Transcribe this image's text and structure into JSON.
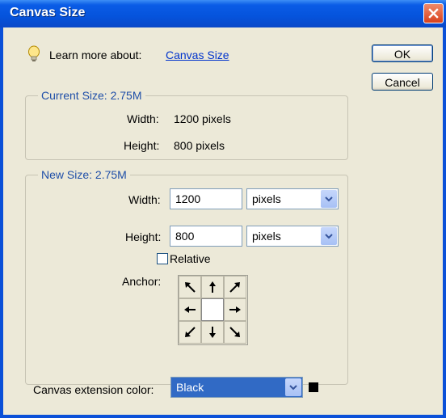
{
  "window": {
    "title": "Canvas Size"
  },
  "help": {
    "prefix": "Learn more about:",
    "link": "Canvas Size"
  },
  "buttons": {
    "ok": "OK",
    "cancel": "Cancel"
  },
  "current_size": {
    "legend": "Current Size: 2.75M",
    "width_label": "Width:",
    "width_value": "1200 pixels",
    "height_label": "Height:",
    "height_value": "800 pixels"
  },
  "new_size": {
    "legend": "New Size: 2.75M",
    "width_label": "Width:",
    "width_value": "1200",
    "width_unit": "pixels",
    "height_label": "Height:",
    "height_value": "800",
    "height_unit": "pixels",
    "relative_label": "Relative",
    "relative_checked": false,
    "anchor_label": "Anchor:"
  },
  "extension": {
    "label": "Canvas extension color:",
    "value": "Black",
    "swatch_color": "#000000"
  },
  "colors": {
    "titlebar": "#0553dc",
    "legend_text": "#1f4fa8",
    "selected_fill": "#316ac5",
    "link": "#0033cc"
  }
}
